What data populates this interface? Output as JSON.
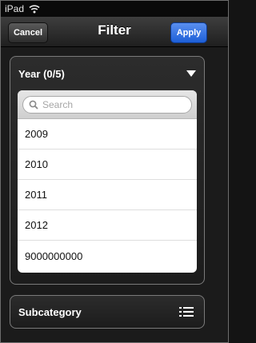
{
  "status_bar": {
    "device": "iPad"
  },
  "nav": {
    "title": "Filter",
    "cancel_label": "Cancel",
    "apply_label": "Apply"
  },
  "year_section": {
    "title": "Year (0/5)",
    "search_placeholder": "Search",
    "items": [
      "2009",
      "2010",
      "2011",
      "2012",
      "9000000000"
    ]
  },
  "subcategory_section": {
    "title": "Subcategory"
  },
  "colors": {
    "apply_button": "#1d5fd8",
    "background": "#1b1b1b"
  }
}
